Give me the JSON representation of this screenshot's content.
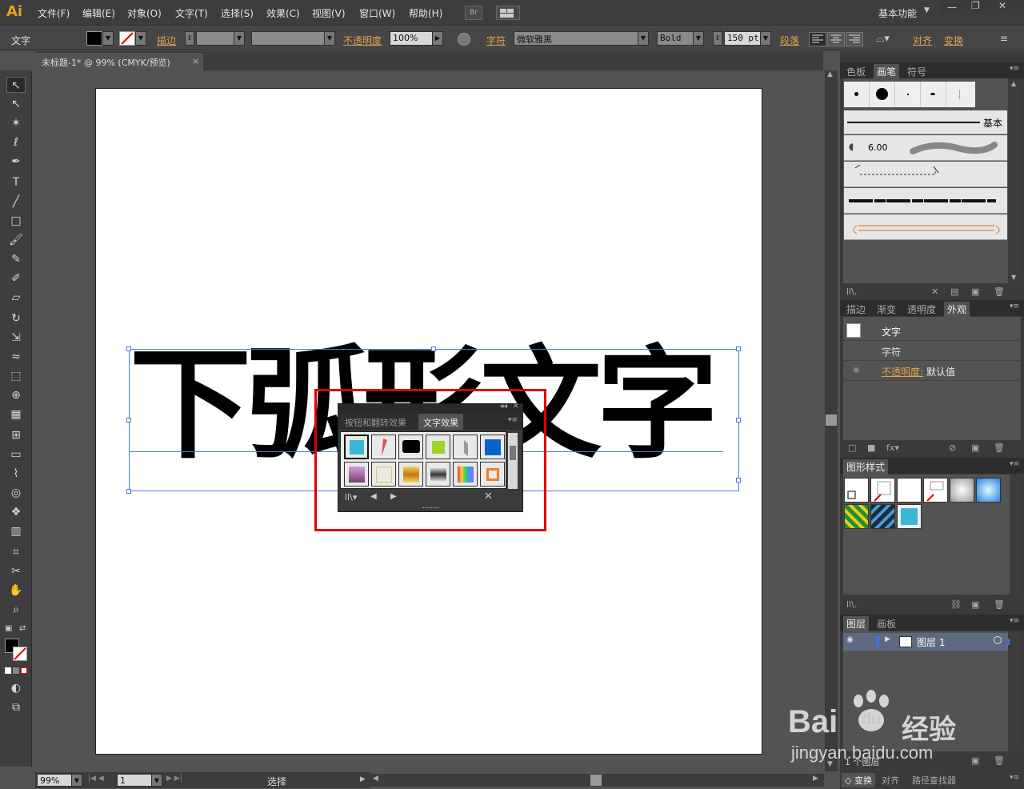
{
  "app": {
    "logo": "Ai"
  },
  "menu": [
    "文件(F)",
    "编辑(E)",
    "对象(O)",
    "文字(T)",
    "选择(S)",
    "效果(C)",
    "视图(V)",
    "窗口(W)",
    "帮助(H)"
  ],
  "menubar": {
    "bridge": "Br",
    "workspace": "基本功能"
  },
  "control": {
    "tool_label": "文字",
    "stroke_label": "描边",
    "opacity_label": "不透明度",
    "opacity_value": "100%",
    "char_label": "字符",
    "font_name": "微软雅黑",
    "font_style": "Bold",
    "font_size": "150 pt",
    "para_label": "段落",
    "align_label": "对齐",
    "transform_label": "变换"
  },
  "document": {
    "tab_title": "未标题-1* @ 99% (CMYK/预览)",
    "artboard_text": "下弧形文字"
  },
  "floating_panel": {
    "tabs": [
      "按钮和翻转效果",
      "文字效果"
    ],
    "active_tab": "文字效果"
  },
  "status": {
    "zoom": "99%",
    "page": "1",
    "tool": "选择"
  },
  "panels": {
    "brush_tabs": [
      "色板",
      "画笔",
      "符号"
    ],
    "brush_active": "画笔",
    "brush_basic": "基本",
    "brush_size": "6.00",
    "appearance_tabs": [
      "描边",
      "渐变",
      "透明度",
      "外观"
    ],
    "appearance_active": "外观",
    "appearance": {
      "title": "文字",
      "char": "字符",
      "opacity_label": "不透明度:",
      "opacity_value": "默认值"
    },
    "graphic_styles": "图形样式",
    "layers_tabs": [
      "图层",
      "画板"
    ],
    "layer_name": "图层 1",
    "layers_count": "1 个图层",
    "bottom_tabs": [
      "变换",
      "对齐",
      "路径查找器"
    ]
  },
  "watermark": {
    "brand_a": "Bai",
    "brand_b": "du",
    "brand_cn": "经验",
    "url": "jingyan.baidu.com"
  },
  "colors": {
    "accent_orange": "#e3a14a",
    "selection_blue": "#4a7bd8",
    "highlight_red": "#e00000"
  }
}
